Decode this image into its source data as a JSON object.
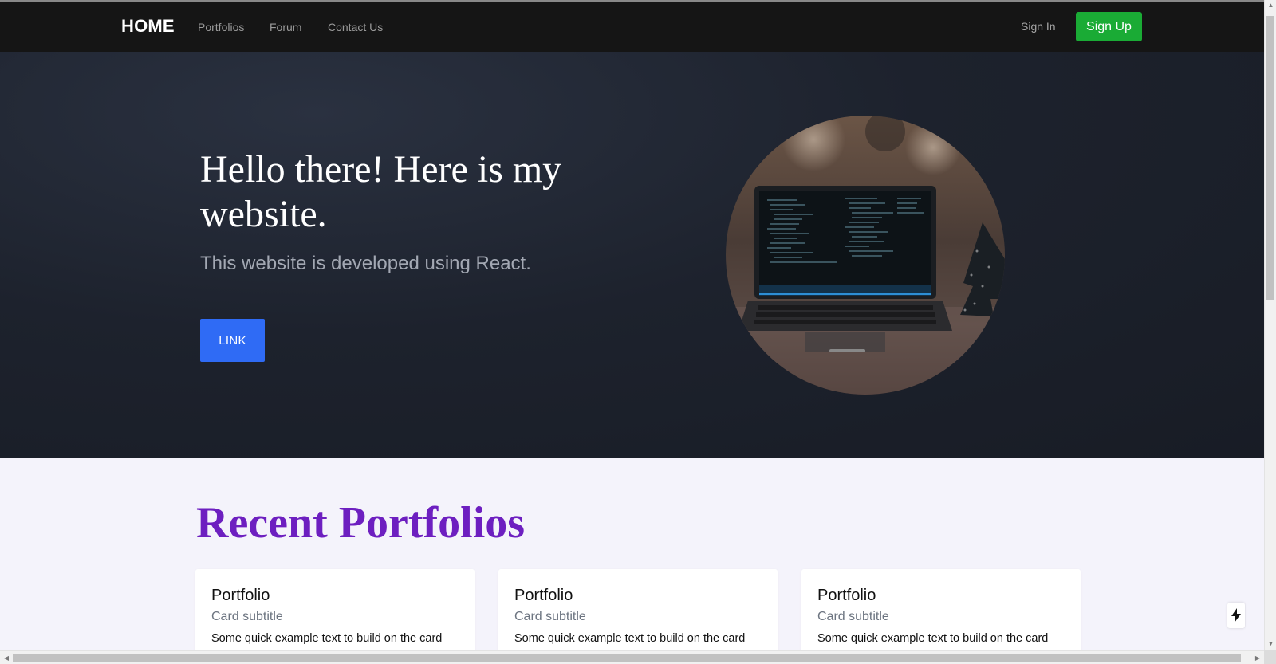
{
  "navbar": {
    "brand": "HOME",
    "links": [
      "Portfolios",
      "Forum",
      "Contact Us"
    ],
    "sign_in": "Sign In",
    "sign_up": "Sign Up"
  },
  "hero": {
    "title": "Hello there! Here is my website.",
    "subtitle": "This website is developed using React.",
    "button": "LINK",
    "image": "laptop-with-code-photo"
  },
  "portfolios": {
    "heading": "Recent Portfolios",
    "cards": [
      {
        "title": "Portfolio",
        "subtitle": "Card subtitle",
        "text": "Some quick example text to build on the card"
      },
      {
        "title": "Portfolio",
        "subtitle": "Card subtitle",
        "text": "Some quick example text to build on the card"
      },
      {
        "title": "Portfolio",
        "subtitle": "Card subtitle",
        "text": "Some quick example text to build on the card"
      }
    ]
  },
  "floating_icon": "bolt-icon",
  "colors": {
    "navbar_bg": "#151515",
    "signup_green": "#1aab35",
    "hero_bg": "#1d222d",
    "link_button_blue": "#2f6bf5",
    "heading_purple": "#6d1fc0",
    "section_bg": "#f4f3fb"
  }
}
